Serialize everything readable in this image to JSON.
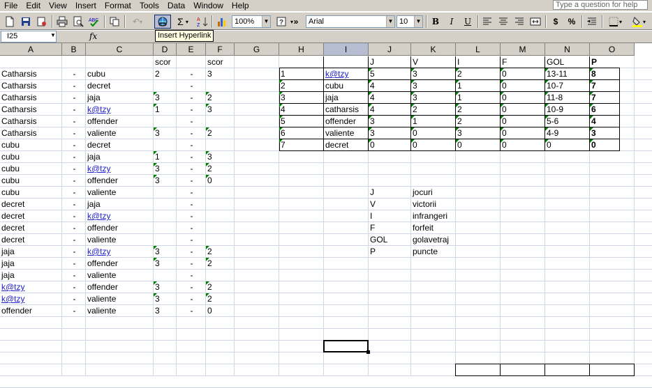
{
  "menu": [
    "File",
    "Edit",
    "View",
    "Insert",
    "Format",
    "Tools",
    "Data",
    "Window",
    "Help"
  ],
  "menu_underline": [
    "F",
    "E",
    "V",
    "I",
    "o",
    "T",
    "D",
    "W",
    "H"
  ],
  "ask_placeholder": "Type a question for help",
  "toolbar": {
    "zoom": "100%",
    "font": "Arial",
    "size": "10",
    "sigma": "Σ",
    "bold": "B",
    "italic": "I",
    "underline": "U",
    "currency": "$",
    "percent": "%",
    "more": "»",
    "help": "?"
  },
  "tooltip": "Insert Hyperlink",
  "namebox": "I25",
  "fx": "fx",
  "columns": [
    "A",
    "B",
    "C",
    "D",
    "E",
    "F",
    "G",
    "H",
    "I",
    "J",
    "K",
    "L",
    "M",
    "N",
    "O"
  ],
  "selected_column": "I",
  "left_header": {
    "D": "scor",
    "F": "scor"
  },
  "matches": [
    {
      "a": "Catharsis",
      "b": "-",
      "c": "cubu",
      "c_link": false,
      "d": "2",
      "e": "-",
      "f": "3",
      "a_link": false
    },
    {
      "a": "Catharsis",
      "b": "-",
      "c": "decret",
      "c_link": false,
      "d": "",
      "e": "-",
      "f": "",
      "a_link": false
    },
    {
      "a": "Catharsis",
      "b": "-",
      "c": "jaja",
      "c_link": false,
      "d": "3",
      "e": "-",
      "f": "2",
      "a_link": false
    },
    {
      "a": "Catharsis",
      "b": "-",
      "c": "k@tzy",
      "c_link": true,
      "d": "1",
      "e": "-",
      "f": "3",
      "a_link": false
    },
    {
      "a": "Catharsis",
      "b": "-",
      "c": "offender",
      "c_link": false,
      "d": "",
      "e": "-",
      "f": "",
      "a_link": false
    },
    {
      "a": "Catharsis",
      "b": "-",
      "c": "valiente",
      "c_link": false,
      "d": "3",
      "e": "-",
      "f": "2",
      "a_link": false
    },
    {
      "a": "cubu",
      "b": "-",
      "c": "decret",
      "c_link": false,
      "d": "",
      "e": "-",
      "f": "",
      "a_link": false
    },
    {
      "a": "cubu",
      "b": "-",
      "c": "jaja",
      "c_link": false,
      "d": "1",
      "e": "-",
      "f": "3",
      "a_link": false
    },
    {
      "a": "cubu",
      "b": "-",
      "c": "k@tzy",
      "c_link": true,
      "d": "3",
      "e": "-",
      "f": "2",
      "a_link": false
    },
    {
      "a": "cubu",
      "b": "-",
      "c": "offender",
      "c_link": false,
      "d": "3",
      "e": "-",
      "f": "0",
      "a_link": false
    },
    {
      "a": "cubu",
      "b": "-",
      "c": "valiente",
      "c_link": false,
      "d": "",
      "e": "-",
      "f": "",
      "a_link": false
    },
    {
      "a": "decret",
      "b": "-",
      "c": "jaja",
      "c_link": false,
      "d": "",
      "e": "-",
      "f": "",
      "a_link": false
    },
    {
      "a": "decret",
      "b": "-",
      "c": "k@tzy",
      "c_link": true,
      "d": "",
      "e": "-",
      "f": "",
      "a_link": false
    },
    {
      "a": "decret",
      "b": "-",
      "c": "offender",
      "c_link": false,
      "d": "",
      "e": "-",
      "f": "",
      "a_link": false
    },
    {
      "a": "decret",
      "b": "-",
      "c": "valiente",
      "c_link": false,
      "d": "",
      "e": "-",
      "f": "",
      "a_link": false
    },
    {
      "a": "jaja",
      "b": "-",
      "c": "k@tzy",
      "c_link": true,
      "d": "3",
      "e": "-",
      "f": "2",
      "a_link": false
    },
    {
      "a": "jaja",
      "b": "-",
      "c": "offender",
      "c_link": false,
      "d": "3",
      "e": "-",
      "f": "2",
      "a_link": false
    },
    {
      "a": "jaja",
      "b": "-",
      "c": "valiente",
      "c_link": false,
      "d": "",
      "e": "-",
      "f": "",
      "a_link": false
    },
    {
      "a": "k@tzy",
      "b": "-",
      "c": "offender",
      "c_link": false,
      "d": "3",
      "e": "-",
      "f": "2",
      "a_link": true
    },
    {
      "a": "k@tzy",
      "b": "-",
      "c": "valiente",
      "c_link": false,
      "d": "3",
      "e": "-",
      "f": "2",
      "a_link": true
    },
    {
      "a": "offender",
      "b": "-",
      "c": "valiente",
      "c_link": false,
      "d": "3",
      "e": "-",
      "f": "0",
      "a_link": false
    }
  ],
  "standings_header": [
    "J",
    "V",
    "I",
    "F",
    "GOL",
    "P"
  ],
  "standings": [
    {
      "rank": "1",
      "team": "k@tzy",
      "link": true,
      "j": "5",
      "v": "3",
      "i": "2",
      "f": "0",
      "gol": "13-11",
      "p": "8"
    },
    {
      "rank": "2",
      "team": "cubu",
      "link": false,
      "j": "4",
      "v": "3",
      "i": "1",
      "f": "0",
      "gol": "10-7",
      "p": "7"
    },
    {
      "rank": "3",
      "team": "jaja",
      "link": false,
      "j": "4",
      "v": "3",
      "i": "1",
      "f": "0",
      "gol": "11-8",
      "p": "7"
    },
    {
      "rank": "4",
      "team": "catharsis",
      "link": false,
      "j": "4",
      "v": "2",
      "i": "2",
      "f": "0",
      "gol": "10-9",
      "p": "6"
    },
    {
      "rank": "5",
      "team": "offender",
      "link": false,
      "j": "3",
      "v": "1",
      "i": "2",
      "f": "0",
      "gol": "5-6",
      "p": "4"
    },
    {
      "rank": "6",
      "team": "valiente",
      "link": false,
      "j": "3",
      "v": "0",
      "i": "3",
      "f": "0",
      "gol": "4-9",
      "p": "3"
    },
    {
      "rank": "7",
      "team": "decret",
      "link": false,
      "j": "0",
      "v": "0",
      "i": "0",
      "f": "0",
      "gol": "0",
      "p": "0"
    }
  ],
  "legend": [
    {
      "key": "J",
      "value": "jocuri"
    },
    {
      "key": "V",
      "value": "victorii"
    },
    {
      "key": "I",
      "value": "infrangeri"
    },
    {
      "key": "F",
      "value": "forfeit"
    },
    {
      "key": "GOL",
      "value": "golavetraj"
    },
    {
      "key": "P",
      "value": "puncte"
    }
  ]
}
